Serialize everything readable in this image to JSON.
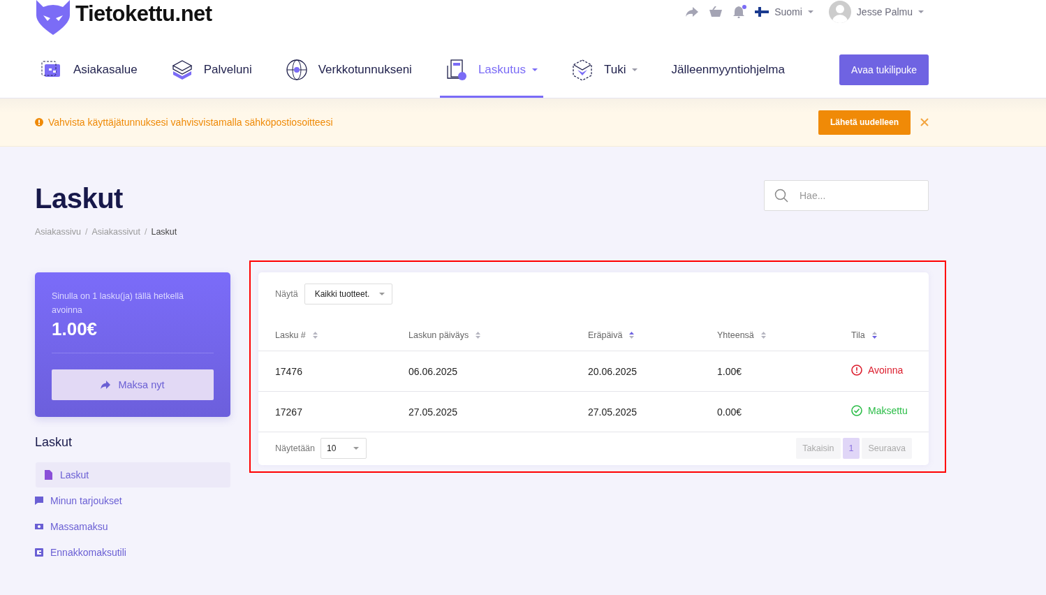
{
  "brand": "Tietokettu.net",
  "language": {
    "label": "Suomi"
  },
  "user": {
    "name": "Jesse Palmu",
    "notification": true
  },
  "nav": [
    {
      "label": "Asiakasalue",
      "selected": false,
      "dropdown": false
    },
    {
      "label": "Palveluni",
      "selected": false,
      "dropdown": false
    },
    {
      "label": "Verkkotunnukseni",
      "selected": false,
      "dropdown": false
    },
    {
      "label": "Laskutus",
      "selected": true,
      "dropdown": true
    },
    {
      "label": "Tuki",
      "selected": false,
      "dropdown": true
    },
    {
      "label": "Jälleenmyyntiohjelma",
      "selected": false,
      "dropdown": false
    }
  ],
  "cta": "Avaa tukilipuke",
  "alert": {
    "message": "Vahvista käyttäjätunnuksesi vahvisvistamalla sähköpostiosoitteesi",
    "button": "Lähetä uudelleen"
  },
  "page": {
    "title": "Laskut",
    "breadcrumb_separator": "/",
    "breadcrumb": [
      {
        "label": "Asiakassivu",
        "current": false
      },
      {
        "label": "Asiakassivut",
        "current": false
      },
      {
        "label": "Laskut",
        "current": true
      }
    ]
  },
  "search": {
    "placeholder": "Hae..."
  },
  "summary": {
    "text": "Sinulla on 1 lasku(ja) tällä hetkellä avoinna",
    "amount": "1.00€",
    "button": "Maksa nyt"
  },
  "sidebar": {
    "title": "Laskut",
    "items": [
      {
        "label": "Laskut",
        "selected": true
      },
      {
        "label": "Minun tarjoukset",
        "selected": false
      },
      {
        "label": "Massamaksu",
        "selected": false
      },
      {
        "label": "Ennakkomaksutili",
        "selected": false
      }
    ]
  },
  "table": {
    "filter_label": "Näytä",
    "filter_value": "Kaikki tuotteet.",
    "columns": [
      {
        "label": "Lasku #",
        "sorted_ascending": false,
        "sorted_descending": false
      },
      {
        "label": "Laskun päiväys",
        "sorted_ascending": false,
        "sorted_descending": false
      },
      {
        "label": "Eräpäivä",
        "sorted_ascending": true,
        "sorted_descending": false
      },
      {
        "label": "Yhteensä",
        "sorted_ascending": false,
        "sorted_descending": false
      },
      {
        "label": "Tila",
        "sorted_ascending": false,
        "sorted_descending": true
      }
    ],
    "rows": [
      {
        "cells": [
          "17476",
          "06.06.2025",
          "20.06.2025",
          "1.00€"
        ],
        "status": {
          "label": "Avoinna",
          "kind": "open"
        }
      },
      {
        "cells": [
          "17267",
          "27.05.2025",
          "27.05.2025",
          "0.00€"
        ],
        "status": {
          "label": "Maksettu",
          "kind": "paid"
        }
      }
    ],
    "page_size_label": "Näytetään",
    "page_size": "10",
    "pages": [
      {
        "label": "Takaisin",
        "disabled": true,
        "selected": false
      },
      {
        "label": "1",
        "disabled": false,
        "selected": true
      },
      {
        "label": "Seuraava",
        "disabled": true,
        "selected": false
      }
    ]
  }
}
